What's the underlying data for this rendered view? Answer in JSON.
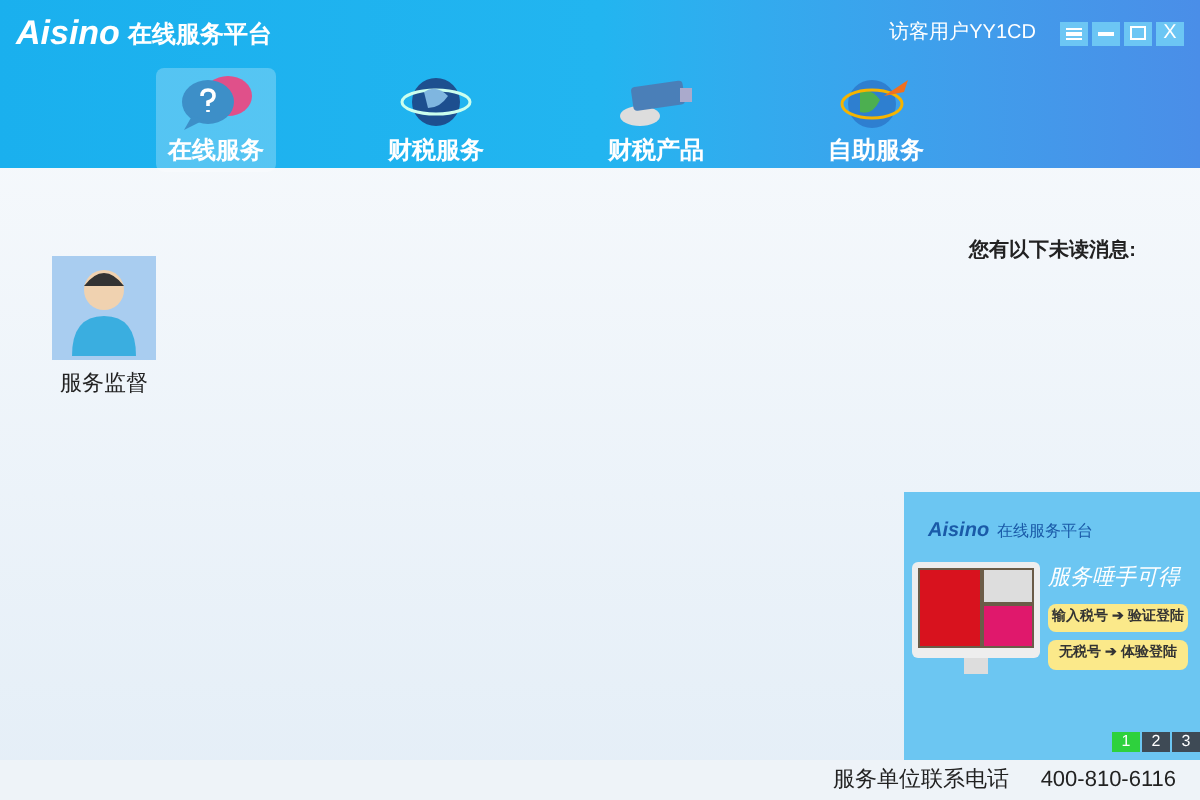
{
  "header": {
    "logo": "Aisino",
    "title": "在线服务平台",
    "user": "访客用户YY1CD",
    "close_label": "X"
  },
  "nav": [
    {
      "label": "在线服务",
      "selected": true,
      "kind": "chat"
    },
    {
      "label": "财税服务",
      "selected": false,
      "kind": "globe"
    },
    {
      "label": "财税产品",
      "selected": false,
      "kind": "usb"
    },
    {
      "label": "自助服务",
      "selected": false,
      "kind": "earth"
    }
  ],
  "apps": [
    {
      "label": "服务监督"
    }
  ],
  "messages": {
    "heading": "您有以下未读消息:"
  },
  "banner": {
    "logo": "Aisino",
    "title": "在线服务平台",
    "slogan": "服务唾手可得",
    "buttons": [
      "输入税号 ➔ 验证登陆",
      "无税号 ➔ 体验登陆"
    ],
    "pages": [
      {
        "label": "1",
        "selected": true
      },
      {
        "label": "2",
        "selected": false
      },
      {
        "label": "3",
        "selected": false
      }
    ]
  },
  "footer": {
    "label": "服务单位联系电话",
    "phone": "400-810-6116"
  }
}
